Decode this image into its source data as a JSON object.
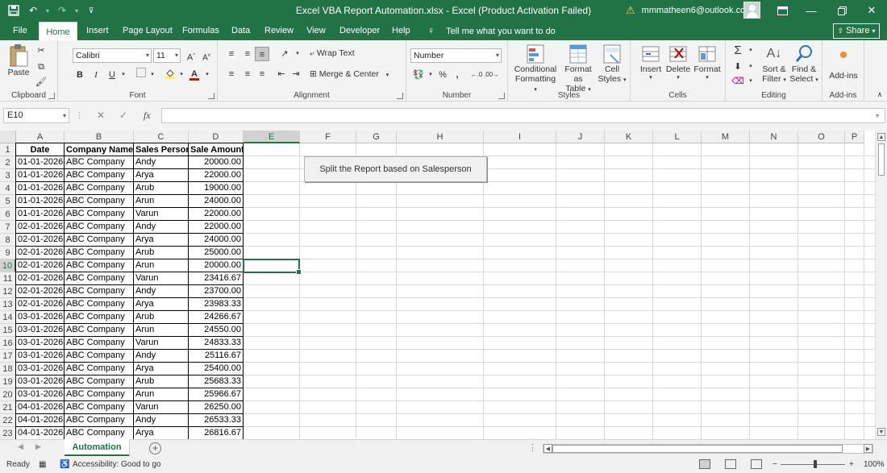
{
  "titlebar": {
    "title": "Excel VBA Report Automation.xlsx  -  Excel (Product Activation Failed)",
    "account": "mmmatheen6@outlook.com",
    "save_icon": "save-icon",
    "undo_icon": "undo-icon",
    "redo_icon": "redo-icon",
    "customize_icon": "customize-qat-icon",
    "ribbon_display_icon": "ribbon-display-icon",
    "minimize_icon": "minimize-icon",
    "restore_icon": "restore-icon",
    "close_icon": "close-icon"
  },
  "tabs": [
    "File",
    "Home",
    "Insert",
    "Page Layout",
    "Formulas",
    "Data",
    "Review",
    "View",
    "Developer",
    "Help"
  ],
  "active_tab": "Home",
  "tell_me": "Tell me what you want to do",
  "share": "Share",
  "ribbon": {
    "clipboard": {
      "label": "Clipboard",
      "paste": "Paste"
    },
    "font": {
      "label": "Font",
      "font_name": "Calibri",
      "font_size": "11",
      "bold": "B",
      "italic": "I",
      "underline": "U"
    },
    "alignment": {
      "label": "Alignment",
      "wrap_text": "Wrap Text",
      "merge_center": "Merge & Center"
    },
    "number": {
      "label": "Number",
      "format": "Number",
      "percent": "%",
      "comma": ","
    },
    "styles": {
      "label": "Styles",
      "conditional_1": "Conditional",
      "conditional_2": "Formatting",
      "format_table_1": "Format as",
      "format_table_2": "Table",
      "cell_styles_1": "Cell",
      "cell_styles_2": "Styles"
    },
    "cells": {
      "label": "Cells",
      "insert": "Insert",
      "delete": "Delete",
      "format": "Format"
    },
    "editing": {
      "label": "Editing",
      "sort_1": "Sort &",
      "sort_2": "Filter",
      "find_1": "Find &",
      "find_2": "Select"
    },
    "addins": {
      "label": "Add-ins",
      "addins": "Add-ins"
    }
  },
  "formula_bar": {
    "name_box": "E10",
    "fx": "fx",
    "cancel": "✕",
    "enter": "✓",
    "value": ""
  },
  "columns": [
    "A",
    "B",
    "C",
    "D",
    "E",
    "F",
    "G",
    "H",
    "I",
    "J",
    "K",
    "L",
    "M",
    "N",
    "O",
    "P"
  ],
  "selected_cell": "E10",
  "headers": [
    "Date",
    "Company Name",
    "Sales Person",
    "Sale Amount"
  ],
  "rows": [
    [
      "01-01-2026",
      "ABC Company",
      "Andy",
      "20000.00"
    ],
    [
      "01-01-2026",
      "ABC Company",
      "Arya",
      "22000.00"
    ],
    [
      "01-01-2026",
      "ABC Company",
      "Arub",
      "19000.00"
    ],
    [
      "01-01-2026",
      "ABC Company",
      "Arun",
      "24000.00"
    ],
    [
      "01-01-2026",
      "ABC Company",
      "Varun",
      "22000.00"
    ],
    [
      "02-01-2026",
      "ABC Company",
      "Andy",
      "22000.00"
    ],
    [
      "02-01-2026",
      "ABC Company",
      "Arya",
      "24000.00"
    ],
    [
      "02-01-2026",
      "ABC Company",
      "Arub",
      "25000.00"
    ],
    [
      "02-01-2026",
      "ABC Company",
      "Arun",
      "20000.00"
    ],
    [
      "02-01-2026",
      "ABC Company",
      "Varun",
      "23416.67"
    ],
    [
      "02-01-2026",
      "ABC Company",
      "Andy",
      "23700.00"
    ],
    [
      "02-01-2026",
      "ABC Company",
      "Arya",
      "23983.33"
    ],
    [
      "03-01-2026",
      "ABC Company",
      "Arub",
      "24266.67"
    ],
    [
      "03-01-2026",
      "ABC Company",
      "Arun",
      "24550.00"
    ],
    [
      "03-01-2026",
      "ABC Company",
      "Varun",
      "24833.33"
    ],
    [
      "03-01-2026",
      "ABC Company",
      "Andy",
      "25116.67"
    ],
    [
      "03-01-2026",
      "ABC Company",
      "Arya",
      "25400.00"
    ],
    [
      "03-01-2026",
      "ABC Company",
      "Arub",
      "25683.33"
    ],
    [
      "03-01-2026",
      "ABC Company",
      "Arun",
      "25966.67"
    ],
    [
      "04-01-2026",
      "ABC Company",
      "Varun",
      "26250.00"
    ],
    [
      "04-01-2026",
      "ABC Company",
      "Andy",
      "26533.33"
    ],
    [
      "04-01-2026",
      "ABC Company",
      "Arya",
      "26816.67"
    ]
  ],
  "macro_button": "Split the Report based on Salesperson",
  "sheet_tab": "Automation",
  "status": {
    "ready": "Ready",
    "accessibility": "Accessibility: Good to go",
    "zoom": "100%"
  },
  "colors": {
    "accent": "#217346",
    "ribbon": "#f3f3f3",
    "warning": "#ffd54a"
  }
}
